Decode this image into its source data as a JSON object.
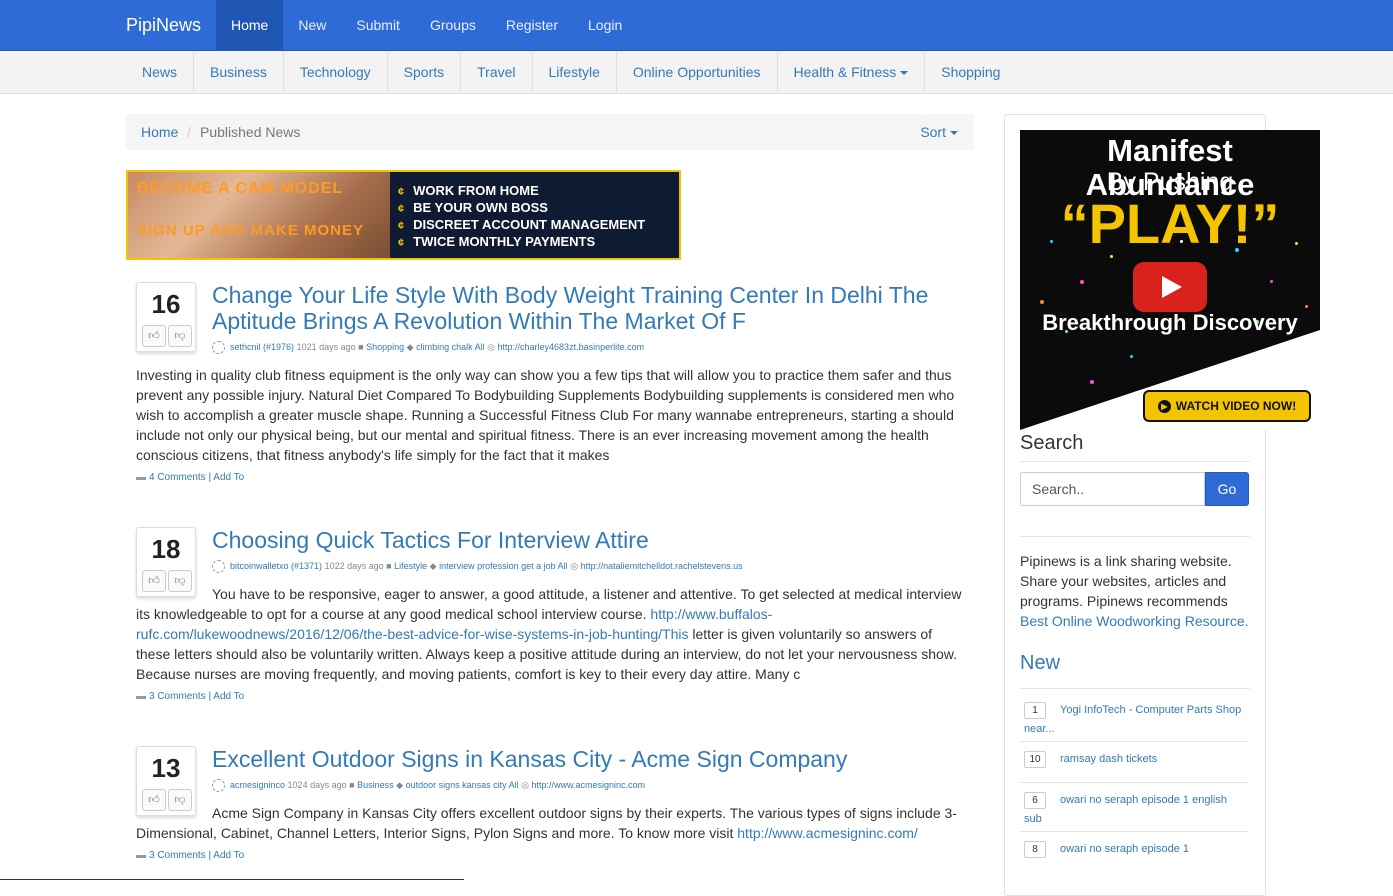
{
  "header": {
    "brand": "PipiNews",
    "nav": [
      "Home",
      "New",
      "Submit",
      "Groups",
      "Register",
      "Login"
    ]
  },
  "categories": [
    "News",
    "Business",
    "Technology",
    "Sports",
    "Travel",
    "Lifestyle",
    "Online Opportunities",
    "Health & Fitness",
    "Shopping"
  ],
  "breadcrumb": {
    "home": "Home",
    "sep": "/",
    "current": "Published News",
    "sort": "Sort"
  },
  "banner": {
    "left_line1": "BECOME A CAM MODEL",
    "left_line2": "SIGN UP AND MAKE MONEY",
    "bullets": [
      "WORK FROM HOME",
      "BE YOUR OWN BOSS",
      "DISCREET ACCOUNT MANAGEMENT",
      "TWICE MONTHLY PAYMENTS"
    ],
    "bullet_glyph": "¢"
  },
  "posts": [
    {
      "votes": "16",
      "title": "Change Your Life Style With Body Weight Training Center In Delhi The Aptitude Brings A Revolution Within The Market Of F",
      "author": "sethcnil (#1976)",
      "age": "1021 days ago",
      "category": "Shopping",
      "tags": "climbing chalk All",
      "url": "http://charley4683zt.basinperlite.com",
      "body": "Investing in quality club fitness equipment is the only way can show you a few tips that will allow you to practice them safer and thus prevent any possible injury. Natural Diet Compared To Bodybuilding Supplements Bodybuilding supplements is considered men who wish to accomplish a greater muscle shape. Running a Successful Fitness Club For many wannabe entrepreneurs, starting a should include not only our physical being, but our mental and spiritual fitness. There is an ever increasing movement among the health conscious citizens, that fitness anybody's life simply for the fact that it makes",
      "comments": "4 Comments",
      "addto": "| Add To"
    },
    {
      "votes": "18",
      "title": "Choosing Quick Tactics For Interview Attire",
      "author": "bitcoinwalletxo (#1371)",
      "age": "1022 days ago",
      "category": "Lifestyle",
      "tags": "interview profession get a job All",
      "url": "http://nataliemitchelldot.rachelstevens.us",
      "body_a": "You have to be responsive, eager to answer, a good attitude, a listener and attentive. To get selected at medical interview its knowledgeable to opt for a course at any good medical school interview course. ",
      "body_link": "http://www.buffalos-rufc.com/lukewoodnews/2016/12/06/the-best-advice-for-wise-systems-in-job-hunting/This",
      "body_b": " letter is given voluntarily so answers of these letters should also be voluntarily written. Always keep a positive attitude during an interview, do not let your nervousness show. Because nurses are moving frequently, and moving patients, comfort is key to their every day attire. Many c",
      "comments": "3 Comments",
      "addto": "| Add To"
    },
    {
      "votes": "13",
      "title": "Excellent Outdoor Signs in Kansas City - Acme Sign Company",
      "author": "acmesigninco",
      "age": "1024 days ago",
      "category": "Business",
      "tags": "outdoor signs kansas city All",
      "url": "http://www.acmesigninc.com",
      "body_a": "Acme Sign Company in Kansas City offers excellent outdoor signs by their experts. The various types of signs include 3-Dimensional, Cabinet, Channel Letters, Interior Signs, Pylon Signs and more. To know more visit ",
      "body_link": "http://www.acmesigninc.com/",
      "comments": "3 Comments",
      "addto": "| Add To"
    }
  ],
  "sidebar": {
    "ad": {
      "line1": "Manifest Abundance",
      "line2": "By Pushing",
      "line3": "“PLAY!”",
      "line4": "Breakthrough Discovery",
      "button": "WATCH VIDEO NOW!"
    },
    "search_heading": "Search",
    "search_placeholder": "Search..",
    "search_button": "Go",
    "about_text": "Pipinews is a link sharing website. Share your websites, articles and programs. Pipinews recommends ",
    "about_link": "Best Online Woodworking Resource.",
    "new_heading": "New",
    "new_items": [
      {
        "count": "1",
        "title": "Yogi InfoTech - Computer Parts Shop near..."
      },
      {
        "count": "10",
        "title": "ramsay dash tickets"
      },
      {
        "count": "6",
        "title": "owari no seraph episode 1 english sub"
      },
      {
        "count": "8",
        "title": "owari no seraph episode 1"
      }
    ]
  },
  "colors": {
    "primary": "#2e6bd6",
    "link": "#337ab7",
    "banner_border": "#f5c400"
  }
}
